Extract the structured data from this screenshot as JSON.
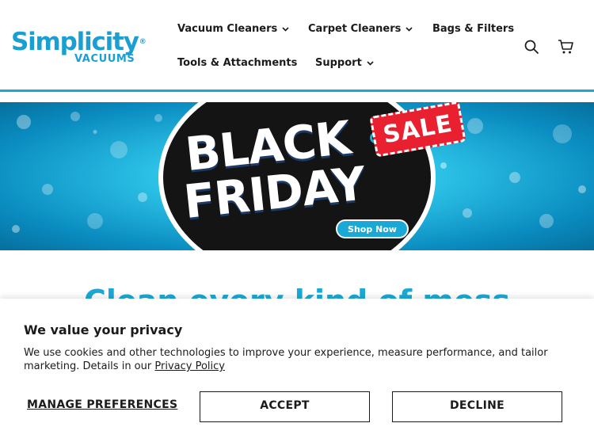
{
  "logo": {
    "main": "Simplicity",
    "tm": "®",
    "sub": "VACUUMS"
  },
  "nav": {
    "items": [
      {
        "label": "Vacuum Cleaners",
        "has_dropdown": true
      },
      {
        "label": "Carpet Cleaners",
        "has_dropdown": true
      },
      {
        "label": "Bags & Filters",
        "has_dropdown": false
      },
      {
        "label": "Tools & Attachments",
        "has_dropdown": false
      },
      {
        "label": "Support",
        "has_dropdown": true
      }
    ]
  },
  "header_icons": {
    "search": "search-icon",
    "cart": "cart-icon"
  },
  "banner": {
    "line1": "BLACK",
    "line2": "FRIDAY",
    "tag": "SALE",
    "cta": "Shop Now"
  },
  "headline": "Clean every kind of mess",
  "cookie": {
    "title": "We value your privacy",
    "text": "We use cookies and other technologies to improve your experience, measure performance, and tailor marketing. Details in our",
    "link": "Privacy Policy",
    "manage": "MANAGE PREFERENCES",
    "accept": "ACCEPT",
    "decline": "DECLINE"
  },
  "colors": {
    "brand": "#1aa9d6",
    "sale": "#e8202f",
    "text": "#1b1b1b"
  }
}
